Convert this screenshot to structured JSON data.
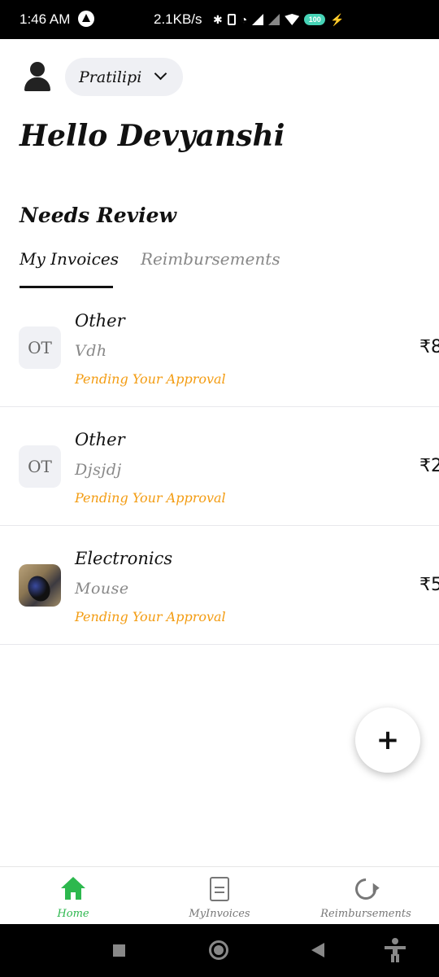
{
  "status_bar": {
    "time": "1:46 AM",
    "network_speed": "2.1KB/s",
    "battery": "100"
  },
  "header": {
    "company": "Pratilipi",
    "greeting": "Hello Devyanshi"
  },
  "section": {
    "title": "Needs Review"
  },
  "tabs": [
    {
      "label": "My Invoices",
      "active": true
    },
    {
      "label": "Reimbursements",
      "active": false
    }
  ],
  "invoices": [
    {
      "initials": "OT",
      "category": "Other",
      "description": "Vdh",
      "status": "Pending Your Approval",
      "amount": "₹8"
    },
    {
      "initials": "OT",
      "category": "Other",
      "description": "Djsjdj",
      "status": "Pending Your Approval",
      "amount": "₹2"
    },
    {
      "initials": "",
      "category": "Electronics",
      "description": "Mouse",
      "status": "Pending Your Approval",
      "amount": "₹5"
    }
  ],
  "fab": {
    "symbol": "+"
  },
  "bottom_nav": [
    {
      "label": "Home",
      "icon": "home-icon",
      "active": true
    },
    {
      "label": "MyInvoices",
      "icon": "document-icon",
      "active": false
    },
    {
      "label": "Reimbursements",
      "icon": "refresh-icon",
      "active": false
    }
  ],
  "colors": {
    "accent_green": "#2db84e",
    "pending_orange": "#f39c12",
    "chip_background": "#eff0f4"
  }
}
